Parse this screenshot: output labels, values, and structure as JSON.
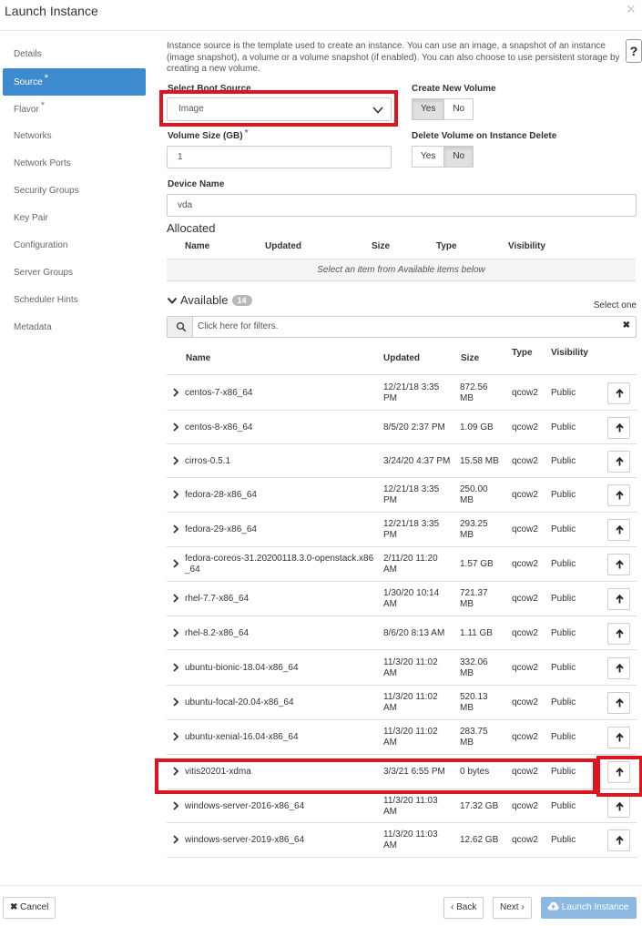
{
  "window": {
    "title": "Launch Instance",
    "close_symbol": "×"
  },
  "sidebar": {
    "items": [
      {
        "label": "Details",
        "required": false
      },
      {
        "label": "Source",
        "required": true
      },
      {
        "label": "Flavor",
        "required": true
      },
      {
        "label": "Networks",
        "required": false
      },
      {
        "label": "Network Ports",
        "required": false
      },
      {
        "label": "Security Groups",
        "required": false
      },
      {
        "label": "Key Pair",
        "required": false
      },
      {
        "label": "Configuration",
        "required": false
      },
      {
        "label": "Server Groups",
        "required": false
      },
      {
        "label": "Scheduler Hints",
        "required": false
      },
      {
        "label": "Metadata",
        "required": false
      }
    ],
    "active_label": "Source",
    "required_marker": "*"
  },
  "source": {
    "help_text": "Instance source is the template used to create an instance. You can use an image, a snapshot of an instance (image snapshot), a volume or a volume snapshot (if enabled). You can also choose to use persistent storage by creating a new volume.",
    "help_icon": "?",
    "boot_source_label": "Select Boot Source",
    "boot_source_value": "Image",
    "create_volume_label": "Create New Volume",
    "create_volume_yes": "Yes",
    "create_volume_no": "No",
    "create_volume_selected": "Yes",
    "volume_size_label": "Volume Size (GB)",
    "volume_size_value": "1",
    "delete_volume_label": "Delete Volume on Instance Delete",
    "delete_volume_yes": "Yes",
    "delete_volume_no": "No",
    "delete_volume_selected": "No",
    "device_name_label": "Device Name",
    "device_name_value": "vda"
  },
  "allocated": {
    "title": "Allocated",
    "headers": {
      "name": "Name",
      "updated": "Updated",
      "size": "Size",
      "type": "Type",
      "visibility": "Visibility"
    },
    "empty_message": "Select an item from Available items below"
  },
  "available": {
    "title": "Available",
    "count": "14",
    "select_hint": "Select one",
    "filter_placeholder": "Click here for filters.",
    "headers": {
      "name": "Name",
      "updated": "Updated",
      "size": "Size",
      "type": "Type",
      "visibility": "Visibility"
    },
    "rows": [
      {
        "name": [
          "centos-7-x86_64"
        ],
        "updated": [
          "12/21/18 3:35",
          "PM"
        ],
        "size": [
          "872.56",
          "MB"
        ],
        "type": "qcow2",
        "visibility": "Public"
      },
      {
        "name": [
          "centos-8-x86_64"
        ],
        "updated": [
          "8/5/20 2:37 PM"
        ],
        "size": [
          "1.09 GB"
        ],
        "type": "qcow2",
        "visibility": "Public"
      },
      {
        "name": [
          "cirros-0.5.1"
        ],
        "updated": [
          "3/24/20 4:37 PM"
        ],
        "size": [
          "15.58 MB"
        ],
        "type": "qcow2",
        "visibility": "Public"
      },
      {
        "name": [
          "fedora-28-x86_64"
        ],
        "updated": [
          "12/21/18 3:35",
          "PM"
        ],
        "size": [
          "250.00",
          "MB"
        ],
        "type": "qcow2",
        "visibility": "Public"
      },
      {
        "name": [
          "fedora-29-x86_64"
        ],
        "updated": [
          "12/21/18 3:35",
          "PM"
        ],
        "size": [
          "293.25",
          "MB"
        ],
        "type": "qcow2",
        "visibility": "Public"
      },
      {
        "name": [
          "fedora-coreos-31.20200118.3.0-openstack.x86",
          "_64"
        ],
        "updated": [
          "2/11/20 11:20",
          "AM"
        ],
        "size": [
          "1.57 GB"
        ],
        "type": "qcow2",
        "visibility": "Public"
      },
      {
        "name": [
          "rhel-7.7-x86_64"
        ],
        "updated": [
          "1/30/20 10:14",
          "AM"
        ],
        "size": [
          "721.37",
          "MB"
        ],
        "type": "qcow2",
        "visibility": "Public"
      },
      {
        "name": [
          "rhel-8.2-x86_64"
        ],
        "updated": [
          "8/6/20 8:13 AM"
        ],
        "size": [
          "1.11 GB"
        ],
        "type": "qcow2",
        "visibility": "Public"
      },
      {
        "name": [
          "ubuntu-bionic-18.04-x86_64"
        ],
        "updated": [
          "11/3/20 11:02",
          "AM"
        ],
        "size": [
          "332.06",
          "MB"
        ],
        "type": "qcow2",
        "visibility": "Public"
      },
      {
        "name": [
          "ubuntu-focal-20.04-x86_64"
        ],
        "updated": [
          "11/3/20 11:02",
          "AM"
        ],
        "size": [
          "520.13",
          "MB"
        ],
        "type": "qcow2",
        "visibility": "Public"
      },
      {
        "name": [
          "ubuntu-xenial-16.04-x86_64"
        ],
        "updated": [
          "11/3/20 11:02",
          "AM"
        ],
        "size": [
          "283.75",
          "MB"
        ],
        "type": "qcow2",
        "visibility": "Public"
      },
      {
        "name": [
          "vitis20201-xdma"
        ],
        "updated": [
          "3/3/21 6:55 PM"
        ],
        "size": [
          "0 bytes"
        ],
        "type": "qcow2",
        "visibility": "Public"
      },
      {
        "name": [
          "windows-server-2016-x86_64"
        ],
        "updated": [
          "11/3/20 11:03",
          "AM"
        ],
        "size": [
          "17.32 GB"
        ],
        "type": "qcow2",
        "visibility": "Public"
      },
      {
        "name": [
          "windows-server-2019-x86_64"
        ],
        "updated": [
          "11/3/20 11:03",
          "AM"
        ],
        "size": [
          "12.62 GB"
        ],
        "type": "qcow2",
        "visibility": "Public"
      }
    ]
  },
  "footer": {
    "cancel_label": "Cancel",
    "back_label": "Back",
    "next_label": "Next",
    "launch_label": "Launch Instance"
  },
  "colors": {
    "accent": "#3d8bce",
    "highlight": "#e0141f",
    "launch_disabled": "#8cb8e2"
  }
}
